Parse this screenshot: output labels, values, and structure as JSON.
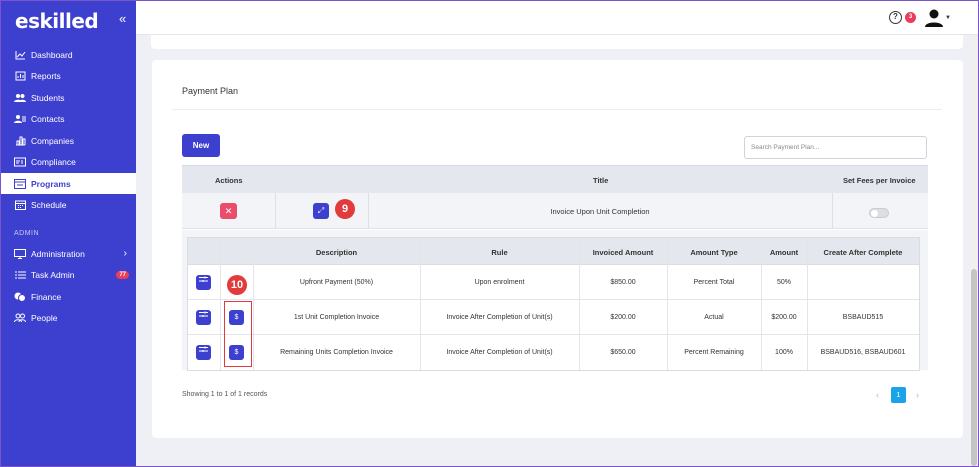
{
  "brand": {
    "logo": "eskilled",
    "collapse_icon": "double-chevron-left-icon"
  },
  "sidebar": {
    "items": [
      {
        "label": "Dashboard",
        "icon": "chart-line-icon"
      },
      {
        "label": "Reports",
        "icon": "report-icon"
      },
      {
        "label": "Students",
        "icon": "users-icon"
      },
      {
        "label": "Contacts",
        "icon": "contacts-icon"
      },
      {
        "label": "Companies",
        "icon": "building-icon"
      },
      {
        "label": "Compliance",
        "icon": "id-card-icon"
      },
      {
        "label": "Programs",
        "icon": "window-icon",
        "active": true
      },
      {
        "label": "Schedule",
        "icon": "calendar-icon"
      }
    ],
    "admin_label": "ADMIN",
    "admin_items": [
      {
        "label": "Administration",
        "icon": "monitor-icon"
      },
      {
        "label": "Task Admin",
        "icon": "list-icon",
        "badge": "77"
      },
      {
        "label": "Finance",
        "icon": "coins-icon"
      },
      {
        "label": "People",
        "icon": "people-icon"
      }
    ]
  },
  "header": {
    "help_icon": "?",
    "help_badge": "3"
  },
  "card": {
    "title": "Payment Plan",
    "new_button": "New",
    "search_placeholder": "Search Payment Plan..."
  },
  "outer_table": {
    "headers": {
      "actions": "Actions",
      "title": "Title",
      "set_fees": "Set Fees per Invoice"
    },
    "row": {
      "delete_icon": "✕",
      "expand_icon": "⤢",
      "title": "Invoice Upon Unit Completion",
      "toggle_on": false
    }
  },
  "markers": {
    "nine": "9",
    "ten": "10"
  },
  "inner_table": {
    "headers": {
      "description": "Description",
      "rule": "Rule",
      "invoiced_amount": "Invoiced Amount",
      "amount_type": "Amount Type",
      "amount": "Amount",
      "create_after": "Create After Complete"
    },
    "rows": [
      {
        "description": "Upfront Payment (50%)",
        "rule": "Upon enrolment",
        "invoiced_amount": "$850.00",
        "amount_type": "Percent Total",
        "amount": "50%",
        "create_after": "",
        "has_fee_button": false
      },
      {
        "description": "1st Unit Completion Invoice",
        "rule": "Invoice After Completion of Unit(s)",
        "invoiced_amount": "$200.00",
        "amount_type": "Actual",
        "amount": "$200.00",
        "create_after": "BSBAUD515",
        "has_fee_button": true
      },
      {
        "description": "Remaining Units Completion Invoice",
        "rule": "Invoice After Completion of Unit(s)",
        "invoiced_amount": "$650.00",
        "amount_type": "Percent Remaining",
        "amount": "100%",
        "create_after": "BSBAUD516, BSBAUD601",
        "has_fee_button": true
      }
    ],
    "fee_button_label": "$"
  },
  "pagination": {
    "records_text": "Showing 1 to 1 of 1 records",
    "current_page": "1",
    "prev": "‹",
    "next": "›"
  }
}
